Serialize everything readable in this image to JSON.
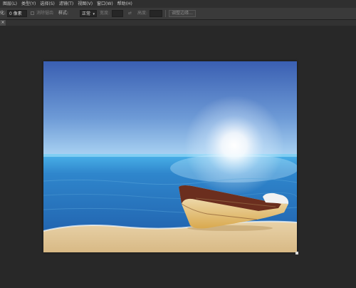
{
  "menu": {
    "items": [
      "图层(L)",
      "类型(Y)",
      "选择(S)",
      "滤镜(T)",
      "视图(V)",
      "窗口(W)",
      "帮助(H)"
    ]
  },
  "options": {
    "feather_label": "化:",
    "feather_value": "0 像素",
    "anti_alias_label": "消除锯齿",
    "style_label": "样式:",
    "style_value": "正常",
    "width_label": "宽度:",
    "height_label": "高度:",
    "refine_edge_label": "调整边缘..."
  },
  "tab": {
    "close_glyph": "×"
  },
  "image": {
    "description_colors": {
      "sky_top": "#3f66b5",
      "sky_horizon": "#9fc9ee",
      "sea": "#2f7fc6",
      "sand": "#e2c79a"
    }
  }
}
